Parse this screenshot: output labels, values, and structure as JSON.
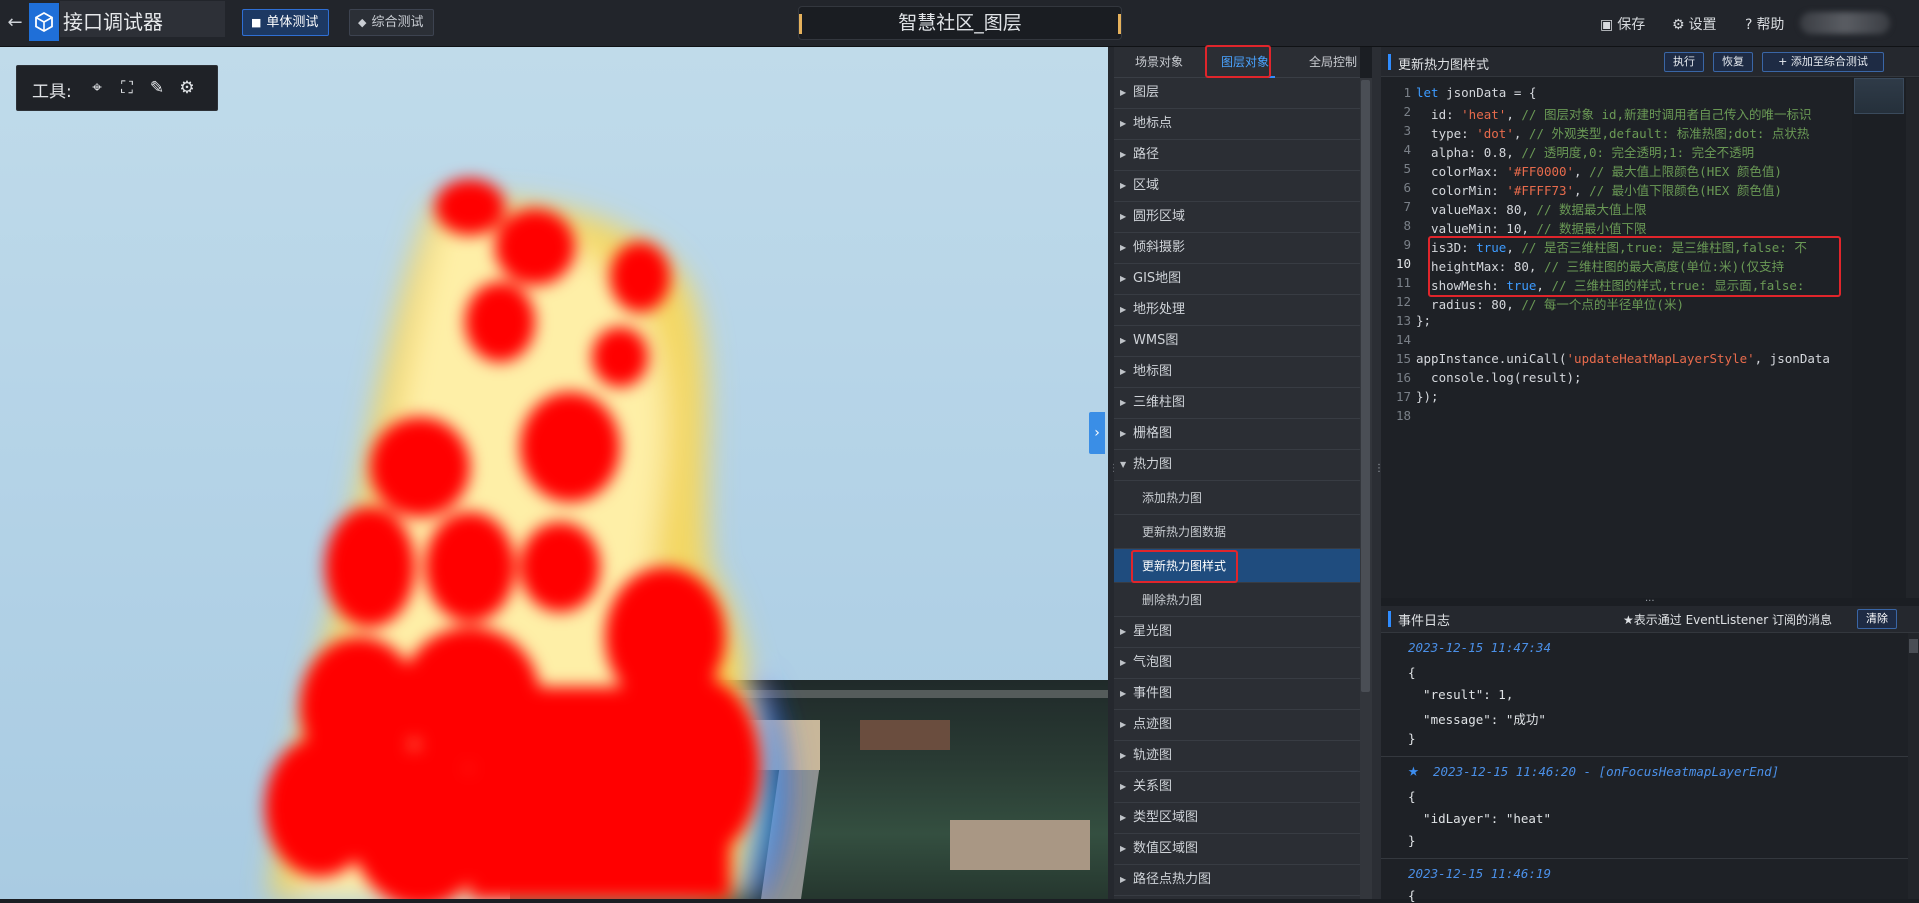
{
  "topbar": {
    "back_icon": "arrow-left-icon",
    "logo_icon": "cube-network-icon",
    "app_title": "接口调试器",
    "mode_buttons": [
      {
        "label": "单体测试",
        "icon": "cube-icon",
        "active": true
      },
      {
        "label": "综合测试",
        "icon": "layers-icon",
        "active": false
      }
    ],
    "scene_title": "智慧社区_图层",
    "save_label": "保存",
    "settings_label": "设置",
    "help_label": "帮助"
  },
  "toolbar": {
    "label": "工具:",
    "icons": [
      "locate-point-icon",
      "frame-select-icon",
      "pen-icon",
      "gear-cluster-icon"
    ]
  },
  "tree": {
    "tabs": [
      {
        "label": "场景对象",
        "active": false
      },
      {
        "label": "图层对象",
        "active": true
      },
      {
        "label": "全局控制",
        "active": false
      }
    ],
    "items_before": [
      "图层",
      "地标点",
      "路径",
      "区域",
      "圆形区域",
      "倾斜摄影",
      "GIS地图",
      "地形处理",
      "WMS图",
      "地标图",
      "三维柱图",
      "栅格图"
    ],
    "expanded_item": "热力图",
    "sub_items": [
      "添加热力图",
      "更新热力图数据",
      "更新热力图样式",
      "删除热力图"
    ],
    "selected_sub": "更新热力图样式",
    "items_after": [
      "星光图",
      "气泡图",
      "事件图",
      "点迹图",
      "轨迹图",
      "关系图",
      "类型区域图",
      "数值区域图",
      "路径点热力图"
    ]
  },
  "editor": {
    "title": "更新热力图样式",
    "run_label": "执行",
    "restore_label": "恢复",
    "add_label": "添加至综合测试",
    "lines": [
      "let jsonData = {",
      "  id: 'heat', // 图层对象 id,新建时调用者自己传入的唯一标识",
      "  type: 'dot', // 外观类型,default: 标准热图;dot: 点状热",
      "  alpha: 0.8, // 透明度,0: 完全透明;1: 完全不透明",
      "  colorMax: '#FF0000', // 最大值上限颜色(HEX 颜色值)",
      "  colorMin: '#FFFF73', // 最小值下限颜色(HEX 颜色值)",
      "  valueMax: 80, // 数据最大值上限",
      "  valueMin: 10, // 数据最小值下限",
      "  is3D: true, // 是否三维柱图,true: 是三维柱图,false: 不",
      "  heightMax: 80, // 三维柱图的最大高度(单位:米)(仅支持",
      "  showMesh: true, // 三维柱图的样式,true: 显示面,false: ",
      "  radius: 80, // 每一个点的半径单位(米)",
      "};",
      "",
      "appInstance.uniCall('updateHeatMapLayerStyle', jsonData",
      "  console.log(result);",
      "});",
      ""
    ]
  },
  "log": {
    "title": "事件日志",
    "note": "★表示通过 EventListener 订阅的消息",
    "clear_label": "清除",
    "entries": [
      {
        "timestamp": "2023-12-15 11:47:34",
        "lines": [
          "{",
          "  \"result\": 1,",
          "  \"message\": \"成功\"",
          "}"
        ]
      },
      {
        "timestamp": "2023-12-15 11:46:20 - [onFocusHeatmapLayerEnd]",
        "starred": true,
        "lines": [
          "{",
          "  \"idLayer\": \"heat\"",
          "}"
        ]
      },
      {
        "timestamp": "2023-12-15 11:46:19",
        "lines": [
          "{"
        ]
      }
    ]
  },
  "colors": {
    "accent": "#2f8cff",
    "highlight_box": "#e0252b",
    "selected_row": "#1f4c7e"
  }
}
